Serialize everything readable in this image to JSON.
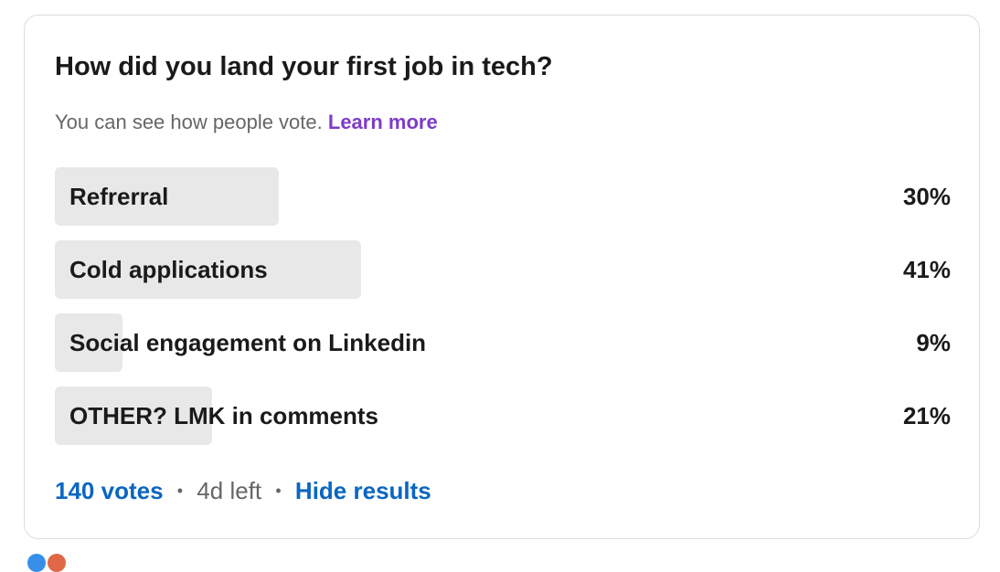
{
  "poll": {
    "question": "How did you land your first job in tech?",
    "visibility_text": "You can see how people vote.",
    "learn_more": "Learn more",
    "options": [
      {
        "label": "Refrerral",
        "percent_text": "30%",
        "percent": 30
      },
      {
        "label": "Cold applications",
        "percent_text": "41%",
        "percent": 41
      },
      {
        "label": "Social engagement on Linkedin",
        "percent_text": "9%",
        "percent": 9
      },
      {
        "label": "OTHER? LMK in comments",
        "percent_text": "21%",
        "percent": 21
      }
    ],
    "votes": "140 votes",
    "separator": "•",
    "time_left": "4d left",
    "hide_results": "Hide results"
  },
  "colors": {
    "link_blue": "#0a66c2",
    "learn_more_purple": "#7d3cc8",
    "bar_fill": "#e8e8e8"
  },
  "reactions": [
    "like-icon",
    "celebrate-icon"
  ]
}
